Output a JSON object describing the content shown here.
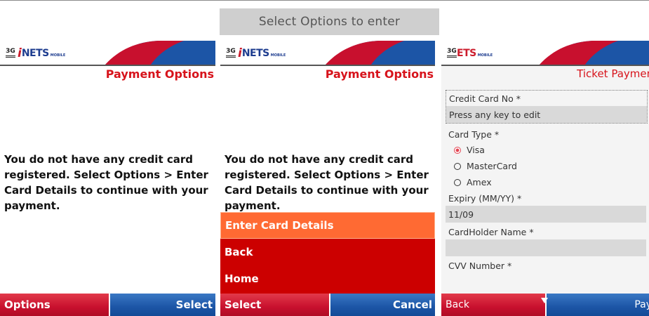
{
  "caption": "Select Options to enter",
  "logo": {
    "prefix": "3G",
    "brand_i": "i",
    "brand": "NETS",
    "suffix": "MOBILE"
  },
  "logo_s3": {
    "prefix": "3G",
    "brand": "ETS",
    "suffix": "MOBILE"
  },
  "screen1": {
    "title": "Payment Options",
    "message": "You do not have any credit card registered. Select Options > Enter Card Details to continue with your payment.",
    "left_soft": "Options",
    "right_soft": "Select"
  },
  "screen2": {
    "title": "Payment Options",
    "message": "You do not have any credit card registered. Select Options > Enter Card Details to continue with your payment.",
    "menu": [
      "Enter Card Details",
      "Back",
      "Home"
    ],
    "left_soft": "Select",
    "right_soft": "Cancel"
  },
  "screen3": {
    "title": "Ticket Payment",
    "cc_label": "Credit Card No *",
    "cc_placeholder": "Press any key to edit",
    "card_type_label": "Card Type *",
    "card_types": [
      "Visa",
      "MasterCard",
      "Amex"
    ],
    "card_type_selected": "Visa",
    "expiry_label": "Expiry (MM/YY) *",
    "expiry_value": "11/09",
    "holder_label": "CardHolder Name *",
    "holder_value": "",
    "cvv_label": "CVV Number *",
    "left_soft": "Back",
    "right_soft": "Pay"
  },
  "colors": {
    "brand_red": "#c8102e",
    "brand_blue": "#1c55a6",
    "menu_red": "#cc0000",
    "menu_highlight": "#ff6a33",
    "title_red": "#d7131b"
  }
}
